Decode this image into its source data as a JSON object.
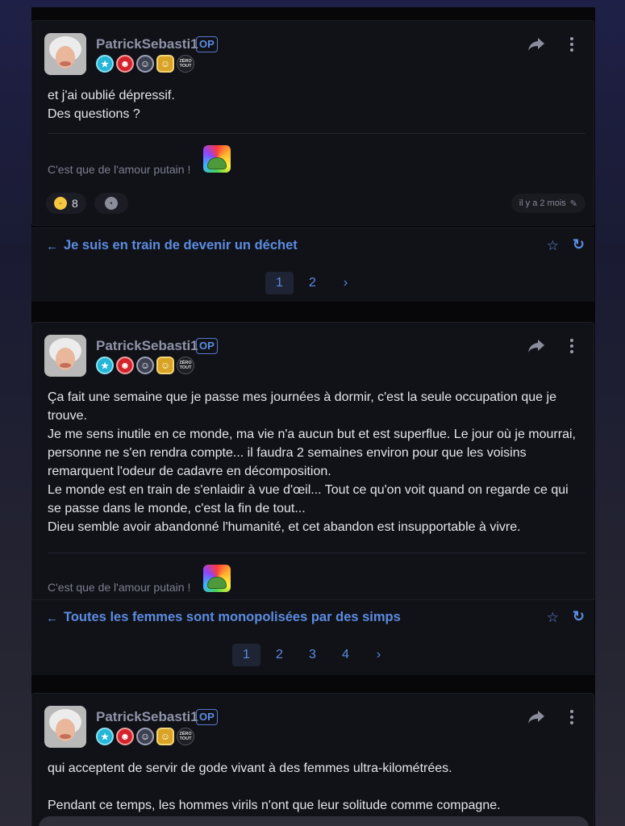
{
  "posts": [
    {
      "username": "PatrickSebasti1",
      "op_label": "OP",
      "badges": [
        "cyan-stars-badge",
        "red-clown-badge",
        "grey-robot-badge",
        "gold-smiley-badge",
        "zero-tout-badge"
      ],
      "badge_zero_text": "ZÉRO TOUT",
      "text_lines": [
        "et j'ai oublié dépressif.",
        "Des questions ?"
      ],
      "signature": "C'est que de l'amour putain !",
      "reactions": [
        {
          "icon": "crying-face-icon",
          "count": "8"
        },
        {
          "icon": "add-reaction-icon",
          "count": ""
        }
      ],
      "time": "il y a 2 mois"
    },
    {
      "username": "PatrickSebasti1",
      "op_label": "OP",
      "text_lines": [
        "Ça fait une semaine que je passe mes journées à dormir, c'est la seule occupation que je trouve.",
        "Je me sens inutile en ce monde, ma vie n'a aucun but et est superflue. Le jour où je mourrai, personne ne s'en rendra compte... il faudra 2 semaines environ pour que les voisins remarquent l'odeur de cadavre en décomposition.",
        "Le monde est en train de s'enlaidir à vue d'œil... Tout ce qu'on voit quand on regarde ce qui se passe dans le monde, c'est la fin de tout...",
        "Dieu semble avoir abandonné l'humanité, et cet abandon est insupportable à vivre."
      ],
      "signature": "C'est que de l'amour putain !"
    },
    {
      "username": "PatrickSebasti1",
      "op_label": "OP",
      "text_lines": [
        "qui acceptent de servir de gode vivant à des femmes ultra-kilométrées.",
        "",
        "Pendant ce temps, les hommes virils n'ont que leur solitude comme compagne."
      ]
    }
  ],
  "topics": [
    {
      "title": "Je suis en train de devenir un déchet",
      "pages": [
        "1",
        "2"
      ],
      "active_page": "1",
      "next": "›"
    },
    {
      "title": "Toutes les femmes sont monopolisées par des simps",
      "pages": [
        "1",
        "2",
        "3",
        "4"
      ],
      "active_page": "1",
      "next": "›"
    }
  ],
  "icons": {
    "back": "←",
    "star": "☆",
    "refresh": "↻",
    "share": "share-icon",
    "more": "more-vertical-icon",
    "edit": "✎"
  },
  "colors": {
    "accent": "#5b8ce0",
    "card": "#111218",
    "background": "#070709"
  }
}
